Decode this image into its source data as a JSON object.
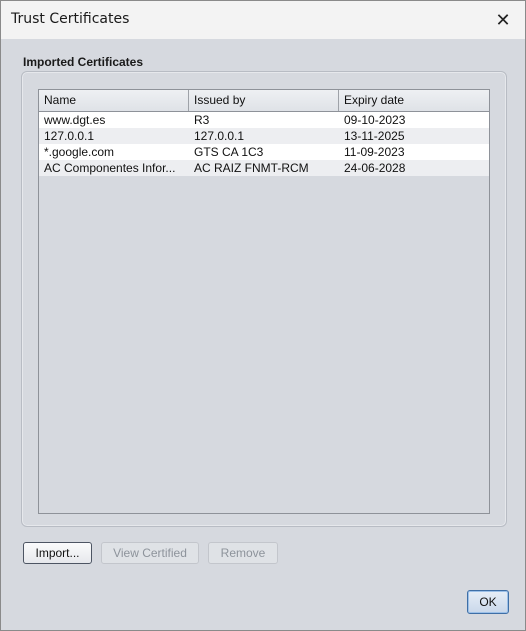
{
  "window": {
    "title": "Trust Certificates"
  },
  "section": {
    "label": "Imported Certificates"
  },
  "table": {
    "columns": [
      "Name",
      "Issued by",
      "Expiry date"
    ],
    "rows": [
      [
        "www.dgt.es",
        "R3",
        "09-10-2023"
      ],
      [
        "127.0.0.1",
        "127.0.0.1",
        "13-11-2025"
      ],
      [
        "*.google.com",
        "GTS CA 1C3",
        "11-09-2023"
      ],
      [
        "AC Componentes Infor...",
        "AC RAIZ FNMT-RCM",
        "24-06-2028"
      ]
    ]
  },
  "buttons": {
    "import": "Import...",
    "view": "View Certified",
    "remove": "Remove",
    "ok": "OK"
  },
  "icons": {
    "close": "close-icon"
  }
}
